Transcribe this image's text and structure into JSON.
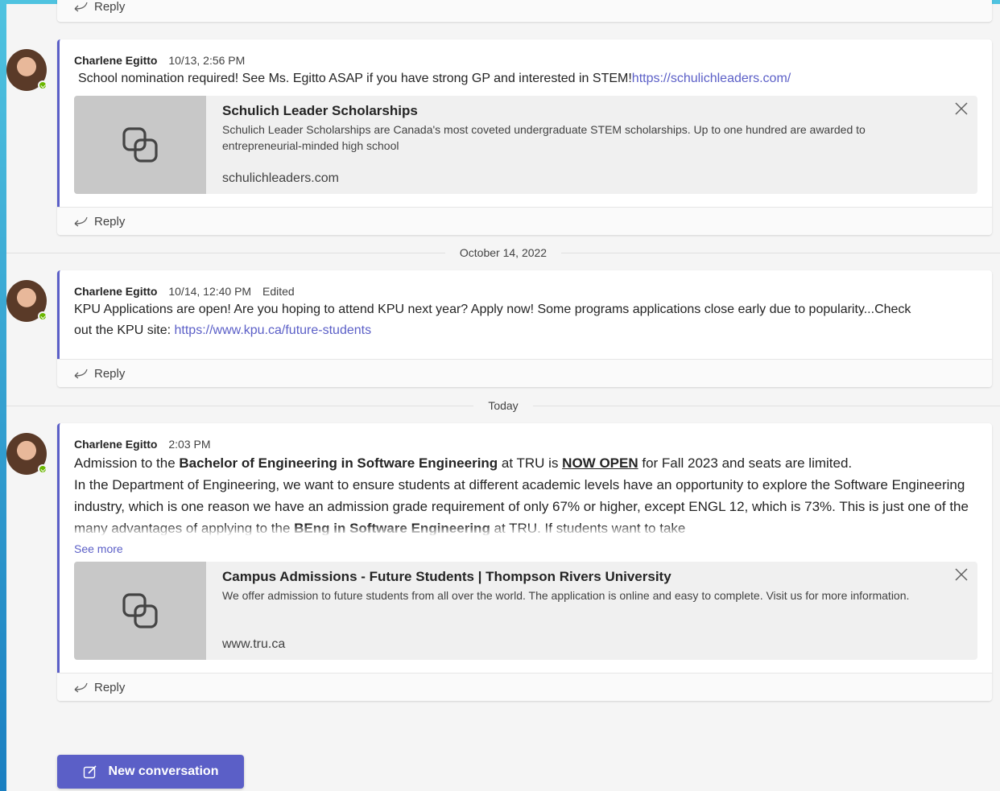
{
  "reply_label": "Reply",
  "new_conversation_label": "New conversation",
  "see_more_label": "See more",
  "dividers": {
    "oct14": "October 14, 2022",
    "today": "Today"
  },
  "posts": [
    {
      "author": "Charlene Egitto",
      "time": "10/13, 2:56 PM",
      "text": "School nomination required! See Ms. Egitto ASAP if you have strong GP and interested in STEM!",
      "link": "https://schulichleaders.com/",
      "preview": {
        "title": "Schulich Leader Scholarships",
        "description": "Schulich Leader Scholarships are Canada's most coveted undergraduate STEM scholarships. Up to one hundred are awarded to entrepreneurial-minded high school",
        "domain": "schulichleaders.com"
      }
    },
    {
      "author": "Charlene Egitto",
      "time": "10/14, 12:40 PM",
      "edited": "Edited",
      "text": "KPU Applications are open! Are you hoping to attend KPU next year? Apply now!  Some programs applications close early due to popularity...Check out the KPU site: ",
      "link": "https://www.kpu.ca/future-students"
    },
    {
      "author": "Charlene Egitto",
      "time": "2:03 PM",
      "line1": {
        "a": "Admission to the ",
        "b": "Bachelor of Engineering in Software Engineering",
        "c": " at TRU is ",
        "d": "NOW OPEN",
        "e": " for Fall 2023 and seats are limited."
      },
      "line2": {
        "a": "In the Department of Engineering, we want to ensure students at different academic levels have an opportunity to explore the Software Engineering industry, which is one reason we have an admission grade requirement of only 67% or higher, except ENGL 12, which is 73%.  This is just one of the many advantages of applying to the ",
        "b": "BEng in Software Engineering",
        "c": " at TRU.  If students want to take"
      },
      "preview": {
        "title": "Campus Admissions - Future Students | Thompson Rivers University",
        "description": "We offer admission to future students from all over the world. The application is online and easy to complete. Visit us for more information.",
        "domain": "www.tru.ca"
      }
    }
  ],
  "colors": {
    "accent": "#5b5fc7",
    "presence": "#6bb700"
  }
}
